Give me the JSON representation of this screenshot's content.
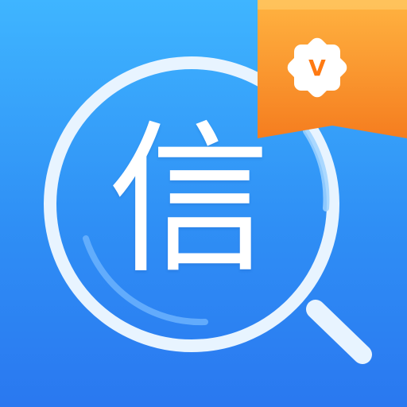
{
  "app_icon": {
    "glyph": "信",
    "badge_letter": "V",
    "icon_names": [
      "magnifier-icon",
      "vip-badge-icon"
    ],
    "colors": {
      "background_top": "#3fb5ff",
      "background_bottom": "#2a78f0",
      "lens_ring": "#e8f4ff",
      "badge_top": "#ffb341",
      "badge_bottom": "#f57d1f",
      "badge_letter": "#ff7a12"
    }
  }
}
